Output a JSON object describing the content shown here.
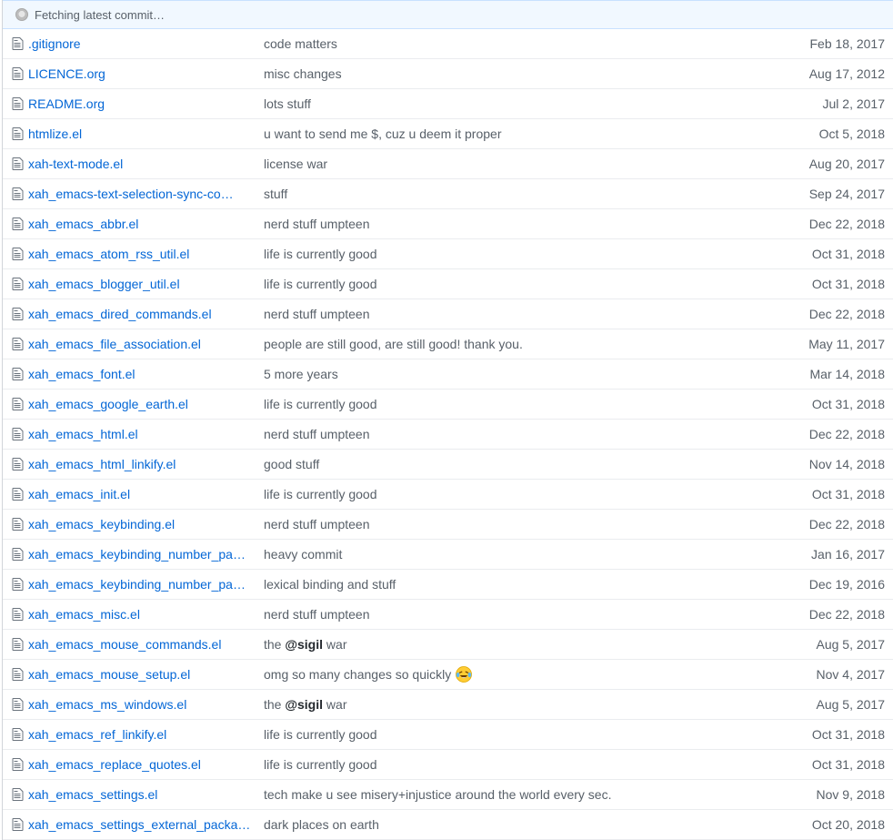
{
  "commit_bar": {
    "text": "Fetching latest commit…",
    "icon": "spinner-icon"
  },
  "files": [
    {
      "name": ".gitignore",
      "message": "code matters",
      "age": "Feb 18, 2017"
    },
    {
      "name": "LICENCE.org",
      "message": "misc changes",
      "age": "Aug 17, 2012"
    },
    {
      "name": "README.org",
      "message": "lots stuff",
      "age": "Jul 2, 2017"
    },
    {
      "name": "htmlize.el",
      "message": "u want to send me $, cuz u deem it proper",
      "age": "Oct 5, 2018"
    },
    {
      "name": "xah-text-mode.el",
      "message": "license war",
      "age": "Aug 20, 2017"
    },
    {
      "name": "xah_emacs-text-selection-sync-co…",
      "message": "stuff",
      "age": "Sep 24, 2017"
    },
    {
      "name": "xah_emacs_abbr.el",
      "message": "nerd stuff umpteen",
      "age": "Dec 22, 2018"
    },
    {
      "name": "xah_emacs_atom_rss_util.el",
      "message": "life is currently good",
      "age": "Oct 31, 2018"
    },
    {
      "name": "xah_emacs_blogger_util.el",
      "message": "life is currently good",
      "age": "Oct 31, 2018"
    },
    {
      "name": "xah_emacs_dired_commands.el",
      "message": "nerd stuff umpteen",
      "age": "Dec 22, 2018"
    },
    {
      "name": "xah_emacs_file_association.el",
      "message": "people are still good, are still good! thank you.",
      "age": "May 11, 2017"
    },
    {
      "name": "xah_emacs_font.el",
      "message": "5 more years",
      "age": "Mar 14, 2018"
    },
    {
      "name": "xah_emacs_google_earth.el",
      "message": "life is currently good",
      "age": "Oct 31, 2018"
    },
    {
      "name": "xah_emacs_html.el",
      "message": "nerd stuff umpteen",
      "age": "Dec 22, 2018"
    },
    {
      "name": "xah_emacs_html_linkify.el",
      "message": "good stuff",
      "age": "Nov 14, 2018"
    },
    {
      "name": "xah_emacs_init.el",
      "message": "life is currently good",
      "age": "Oct 31, 2018"
    },
    {
      "name": "xah_emacs_keybinding.el",
      "message": "nerd stuff umpteen",
      "age": "Dec 22, 2018"
    },
    {
      "name": "xah_emacs_keybinding_number_pad…",
      "message": "heavy commit",
      "age": "Jan 16, 2017"
    },
    {
      "name": "xah_emacs_keybinding_number_pad…",
      "message": "lexical binding and stuff",
      "age": "Dec 19, 2016"
    },
    {
      "name": "xah_emacs_misc.el",
      "message": "nerd stuff umpteen",
      "age": "Dec 22, 2018"
    },
    {
      "name": "xah_emacs_mouse_commands.el",
      "message_prefix": "the ",
      "message_bold": "@sigil",
      "message_suffix": " war",
      "age": "Aug 5, 2017"
    },
    {
      "name": "xah_emacs_mouse_setup.el",
      "message": "omg so many changes so quickly",
      "emoji": "laughing-tears-emoji",
      "age": "Nov 4, 2017"
    },
    {
      "name": "xah_emacs_ms_windows.el",
      "message_prefix": "the ",
      "message_bold": "@sigil",
      "message_suffix": " war",
      "age": "Aug 5, 2017"
    },
    {
      "name": "xah_emacs_ref_linkify.el",
      "message": "life is currently good",
      "age": "Oct 31, 2018"
    },
    {
      "name": "xah_emacs_replace_quotes.el",
      "message": "life is currently good",
      "age": "Oct 31, 2018"
    },
    {
      "name": "xah_emacs_settings.el",
      "message": "tech make u see misery+injustice around the world every sec.",
      "age": "Nov 9, 2018"
    },
    {
      "name": "xah_emacs_settings_external_packa…",
      "message": "dark places on earth",
      "age": "Oct 20, 2018"
    }
  ],
  "colors": {
    "link": "#0366d6",
    "muted": "#586069",
    "commit_bar_bg": "#f1f8ff",
    "row_border": "#eaecef"
  },
  "file_icon": "file-text-icon"
}
